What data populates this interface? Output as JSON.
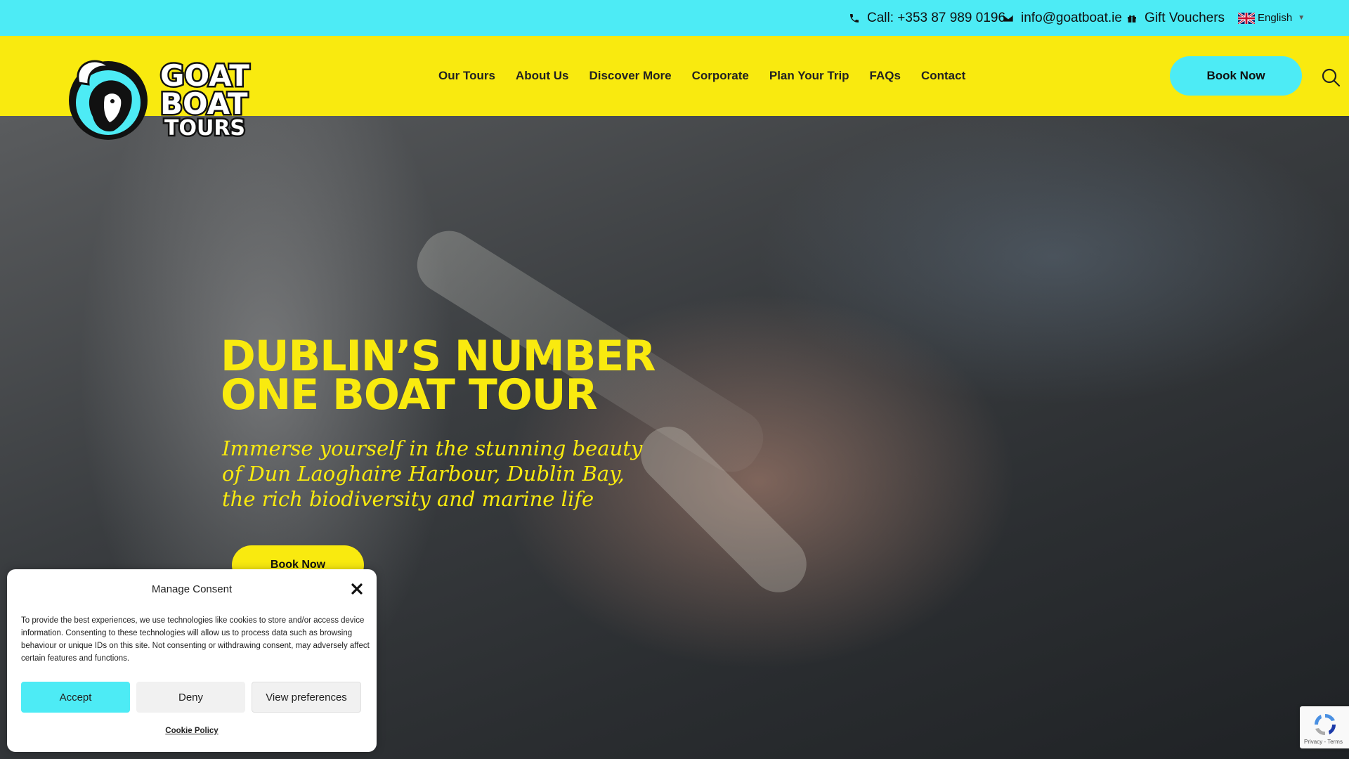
{
  "topbar": {
    "phone": "Call: +353 87 989 0196",
    "email": "info@goatboat.ie",
    "gift": "Gift Vouchers",
    "language": "English"
  },
  "logo": {
    "line1": "GOAT",
    "line2": "BOAT",
    "line3": "TOURS"
  },
  "nav": {
    "items": [
      "Our Tours",
      "About Us",
      "Discover More",
      "Corporate",
      "Plan Your Trip",
      "FAQs",
      "Contact"
    ]
  },
  "header": {
    "book_now": "Book Now"
  },
  "hero": {
    "title_line1": "DUBLIN’S NUMBER",
    "title_line2": "ONE BOAT TOUR",
    "subtitle": "Immerse yourself in the stunning beauty of Dun Laoghaire Harbour, Dublin Bay, the rich biodiversity and marine life",
    "button": "Book Now"
  },
  "consent": {
    "title": "Manage Consent",
    "text": "To provide the best experiences, we use technologies like cookies to store and/or access device information. Consenting to these technologies will allow us to process data such as browsing behaviour or unique IDs on this site. Not consenting or withdrawing consent, may adversely affect certain features and functions.",
    "accept": "Accept",
    "deny": "Deny",
    "preferences": "View preferences",
    "policy": "Cookie Policy"
  },
  "recaptcha": {
    "text": "Privacy - Terms"
  },
  "colors": {
    "cyan": "#4debf5",
    "yellow": "#f9ea0f"
  }
}
